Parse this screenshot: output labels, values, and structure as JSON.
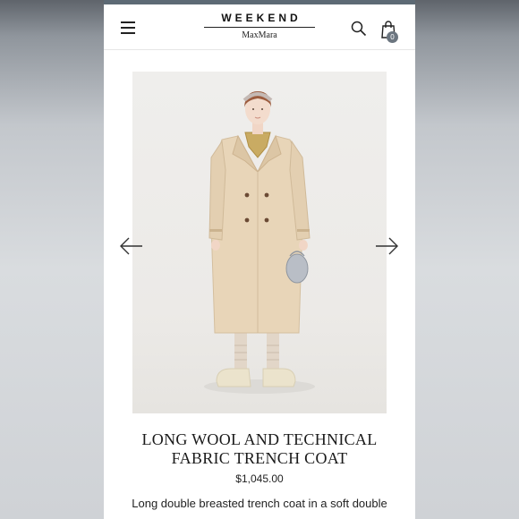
{
  "header": {
    "brand_top": "WEEKEND",
    "brand_bottom": "MaxMara",
    "cart_count": "0"
  },
  "icons": [
    "menu-icon",
    "search-icon",
    "shopping-bag-icon",
    "arrow-left-icon",
    "arrow-right-icon"
  ],
  "product": {
    "title_line1": "LONG WOOL AND TECHNICAL",
    "title_line2": "FABRIC TRENCH COAT",
    "price": "$1,045.00",
    "description": "Long double breasted trench coat in a soft double"
  },
  "colors": {
    "status_strip": "#5d6a75",
    "cart_badge": "#6c7680",
    "coat": "#e6d2b5",
    "image_background": "#eeedeb"
  }
}
